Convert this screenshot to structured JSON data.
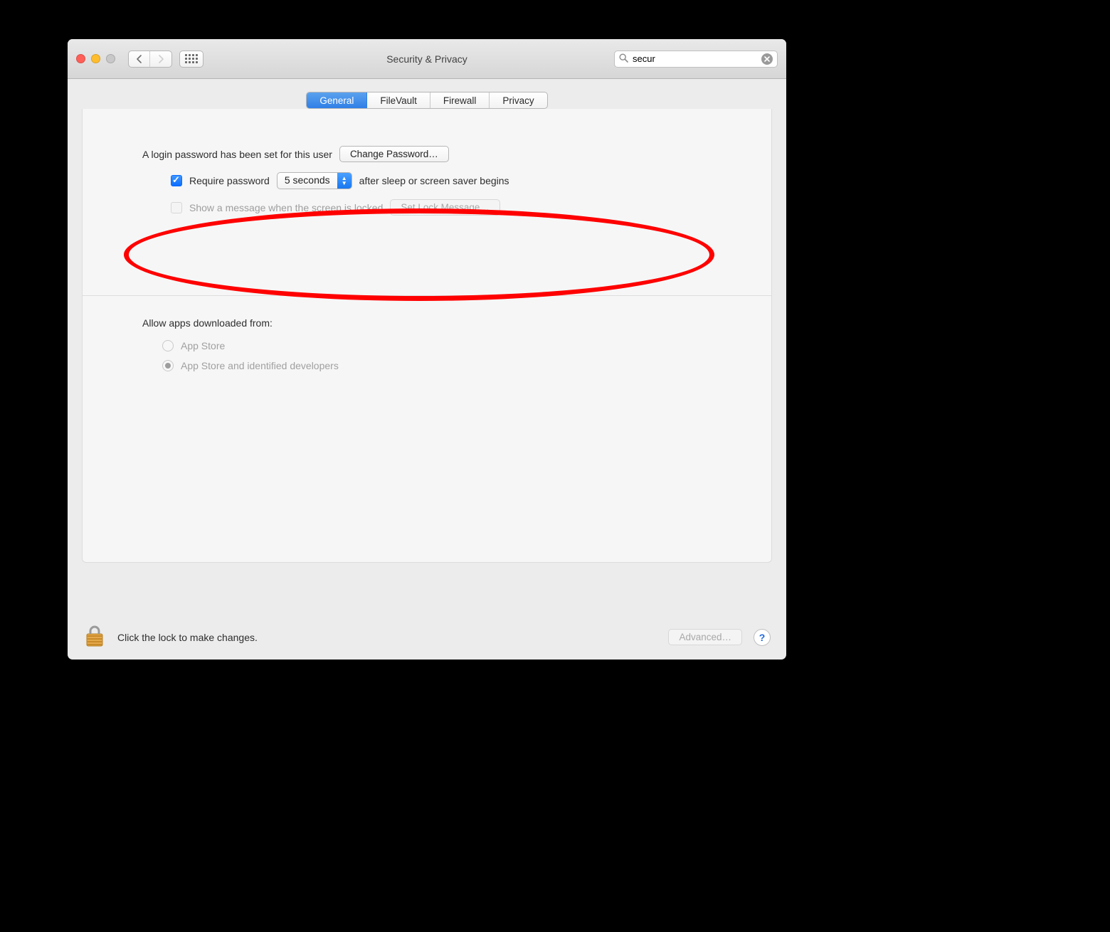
{
  "window": {
    "title": "Security & Privacy"
  },
  "toolbar": {
    "search_value": "secur"
  },
  "tabs": {
    "items": [
      {
        "label": "General"
      },
      {
        "label": "FileVault"
      },
      {
        "label": "Firewall"
      },
      {
        "label": "Privacy"
      }
    ],
    "active_index": 0
  },
  "general": {
    "login_password_text": "A login password has been set for this user",
    "change_password_label": "Change Password…",
    "require_password_label": "Require password",
    "delay_value": "5 seconds",
    "after_sleep_text": "after sleep or screen saver begins",
    "show_message_label": "Show a message when the screen is locked",
    "set_lock_message_label": "Set Lock Message…",
    "allow_apps_heading": "Allow apps downloaded from:",
    "options": [
      "App Store",
      "App Store and identified developers"
    ],
    "selected_option_index": 1
  },
  "footer": {
    "lock_text": "Click the lock to make changes.",
    "advanced_label": "Advanced…",
    "help_label": "?"
  }
}
